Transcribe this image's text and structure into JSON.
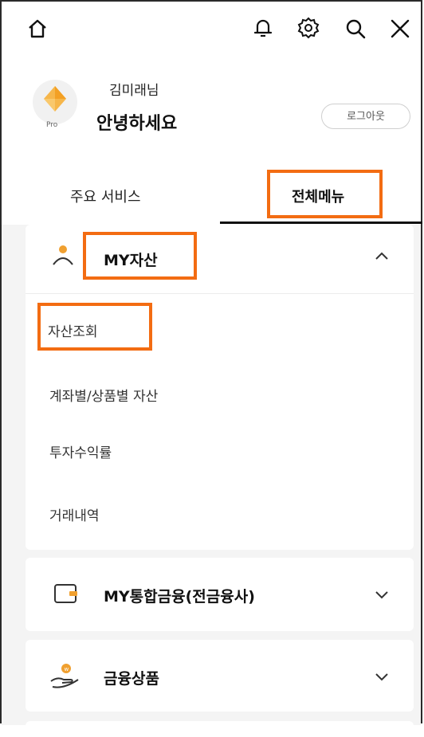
{
  "topbar": {
    "icons": [
      "home-icon",
      "bell-icon",
      "gear-icon",
      "search-icon",
      "close-icon"
    ]
  },
  "profile": {
    "badge": "Pro",
    "name": "김미래님",
    "greeting": "안녕하세요",
    "logout_label": "로그아웃"
  },
  "tabs": [
    {
      "label": "주요 서비스",
      "active": false
    },
    {
      "label": "전체메뉴",
      "active": true
    }
  ],
  "menu": {
    "sections": [
      {
        "title": "MY자산",
        "icon": "person-icon",
        "expanded": true,
        "items": [
          "자산조회",
          "계좌별/상품별 자산",
          "투자수익률",
          "거래내역"
        ]
      },
      {
        "title": "MY통합금융(전금융사)",
        "icon": "wallet-icon",
        "expanded": false
      },
      {
        "title": "금융상품",
        "icon": "hand-coin-icon",
        "expanded": false
      }
    ]
  },
  "colors": {
    "highlight": "#f36c12",
    "accent_orange": "#f0a030",
    "background": "#f4f4f4"
  }
}
